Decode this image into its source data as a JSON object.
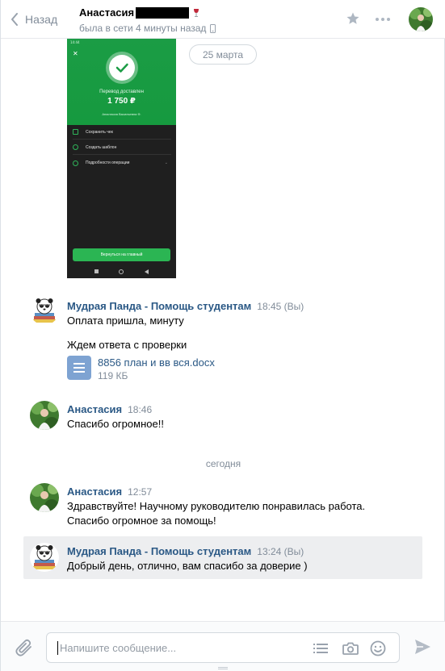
{
  "header": {
    "back_label": "Назад",
    "peer_name": "Анастасия",
    "peer_status": "была в сети 4 минуты назад"
  },
  "attachment_screenshot": {
    "status_time": "14:44",
    "title": "Перевод доставлен",
    "amount": "1 750 ₽",
    "recipient": "Анастасия Васильевна Ф.",
    "rows": [
      "Сохранить чек",
      "Создать шаблон",
      "Подробности операции"
    ],
    "button": "Вернуться на главный"
  },
  "date_pill": "25 марта",
  "date_separator": "сегодня",
  "messages": [
    {
      "author": "Мудрая Панда - Помощь студентам",
      "time": "18:45 (Вы)",
      "lines": [
        "Оплата пришла, минуту",
        "Ждем ответа с проверки"
      ],
      "doc": {
        "name": "8856 план и вв вся.docx",
        "size": "119 КБ"
      }
    },
    {
      "author": "Анастасия",
      "time": "18:46",
      "lines": [
        "Спасибо огромное!!"
      ]
    },
    {
      "author": "Анастасия",
      "time": "12:57",
      "lines": [
        "Здравствуйте! Научному руководителю понравилась работа.",
        "Спасибо огромное за помощь!"
      ]
    },
    {
      "author": "Мудрая Панда - Помощь студентам",
      "time": "13:24 (Вы)",
      "lines": [
        "Добрый день, отлично, вам спасибо за доверие )"
      ]
    }
  ],
  "composer": {
    "placeholder": "Напишите сообщение..."
  },
  "colors": {
    "link": "#2a5885",
    "muted": "#818c99",
    "highlight_bg": "#edeef0",
    "sber_green": "#1b9c45"
  }
}
